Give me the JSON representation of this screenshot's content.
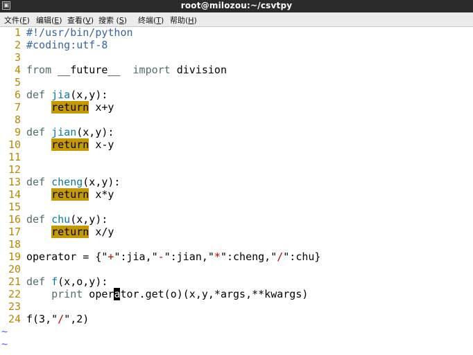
{
  "window": {
    "title": "root@milozou:~/csvtpy",
    "sys_icon": "window-menu-icon"
  },
  "menu": [
    {
      "label": "文件(",
      "mnemonic": "F",
      "suffix": ")"
    },
    {
      "label": "编辑(",
      "mnemonic": "E",
      "suffix": ")"
    },
    {
      "label": "查看(",
      "mnemonic": "V",
      "suffix": ")"
    },
    {
      "label": "搜索 (",
      "mnemonic": "S",
      "suffix": ")"
    },
    {
      "label": "终端(",
      "mnemonic": "T",
      "suffix": ")"
    },
    {
      "label": "帮助(",
      "mnemonic": "H",
      "suffix": ")"
    }
  ],
  "editor": {
    "colors": {
      "line_number": "#b58a00",
      "comment": "#3465a4",
      "keyword": "#4e6e6e",
      "function_name": "#0a7a9a",
      "string": "#c00000",
      "return_highlight": "#c49a00",
      "tilde": "#5a5aff"
    },
    "lines": [
      {
        "n": "1",
        "tokens": [
          {
            "t": "#!/usr/bin/python",
            "c": "comment"
          }
        ]
      },
      {
        "n": "2",
        "tokens": [
          {
            "t": "#coding:utf-8",
            "c": "comment"
          }
        ]
      },
      {
        "n": "3",
        "tokens": []
      },
      {
        "n": "4",
        "tokens": [
          {
            "t": "from",
            "c": "keyword"
          },
          {
            "t": " __future__  ",
            "c": ""
          },
          {
            "t": "import",
            "c": "keyword"
          },
          {
            "t": " division",
            "c": ""
          }
        ]
      },
      {
        "n": "5",
        "tokens": []
      },
      {
        "n": "6",
        "tokens": [
          {
            "t": "def",
            "c": "keyword"
          },
          {
            "t": " ",
            "c": ""
          },
          {
            "t": "jia",
            "c": "func"
          },
          {
            "t": "(x,y):",
            "c": ""
          }
        ]
      },
      {
        "n": "7",
        "tokens": [
          {
            "t": "    ",
            "c": ""
          },
          {
            "t": "return",
            "c": "return"
          },
          {
            "t": " x+y",
            "c": ""
          }
        ]
      },
      {
        "n": "8",
        "tokens": []
      },
      {
        "n": "9",
        "tokens": [
          {
            "t": "def",
            "c": "keyword"
          },
          {
            "t": " ",
            "c": ""
          },
          {
            "t": "jian",
            "c": "func"
          },
          {
            "t": "(x,y):",
            "c": ""
          }
        ]
      },
      {
        "n": "10",
        "tokens": [
          {
            "t": "    ",
            "c": ""
          },
          {
            "t": "return",
            "c": "return"
          },
          {
            "t": " x-y",
            "c": ""
          }
        ]
      },
      {
        "n": "11",
        "tokens": []
      },
      {
        "n": "12",
        "tokens": []
      },
      {
        "n": "13",
        "tokens": [
          {
            "t": "def",
            "c": "keyword"
          },
          {
            "t": " ",
            "c": ""
          },
          {
            "t": "cheng",
            "c": "func"
          },
          {
            "t": "(x,y):",
            "c": ""
          }
        ]
      },
      {
        "n": "14",
        "tokens": [
          {
            "t": "    ",
            "c": ""
          },
          {
            "t": "return",
            "c": "return"
          },
          {
            "t": " x*y",
            "c": ""
          }
        ]
      },
      {
        "n": "15",
        "tokens": []
      },
      {
        "n": "16",
        "tokens": [
          {
            "t": "def",
            "c": "keyword"
          },
          {
            "t": " ",
            "c": ""
          },
          {
            "t": "chu",
            "c": "func"
          },
          {
            "t": "(x,y):",
            "c": ""
          }
        ]
      },
      {
        "n": "17",
        "tokens": [
          {
            "t": "    ",
            "c": ""
          },
          {
            "t": "return",
            "c": "return"
          },
          {
            "t": " x/y",
            "c": ""
          }
        ]
      },
      {
        "n": "18",
        "tokens": []
      },
      {
        "n": "19",
        "tokens": [
          {
            "t": "operator = {\"",
            "c": ""
          },
          {
            "t": "+",
            "c": "string"
          },
          {
            "t": "\":jia,\"",
            "c": ""
          },
          {
            "t": "-",
            "c": "string"
          },
          {
            "t": "\":jian,\"",
            "c": ""
          },
          {
            "t": "*",
            "c": "string"
          },
          {
            "t": "\":cheng,\"",
            "c": ""
          },
          {
            "t": "/",
            "c": "string"
          },
          {
            "t": "\":chu}",
            "c": ""
          }
        ]
      },
      {
        "n": "20",
        "tokens": []
      },
      {
        "n": "21",
        "tokens": [
          {
            "t": "def",
            "c": "keyword"
          },
          {
            "t": " ",
            "c": ""
          },
          {
            "t": "f",
            "c": "func"
          },
          {
            "t": "(x,o,y):",
            "c": ""
          }
        ]
      },
      {
        "n": "22",
        "tokens": [
          {
            "t": "    ",
            "c": ""
          },
          {
            "t": "print",
            "c": "keyword"
          },
          {
            "t": " oper",
            "c": ""
          },
          {
            "t": "a",
            "c": "cursor"
          },
          {
            "t": "tor.get(o)(x,y,*args,**kwargs)",
            "c": ""
          }
        ]
      },
      {
        "n": "23",
        "tokens": []
      },
      {
        "n": "24",
        "tokens": [
          {
            "t": "f(3,\"",
            "c": ""
          },
          {
            "t": "/",
            "c": "string"
          },
          {
            "t": "\",2)",
            "c": ""
          }
        ]
      }
    ],
    "tildes": [
      "~",
      "~"
    ]
  }
}
